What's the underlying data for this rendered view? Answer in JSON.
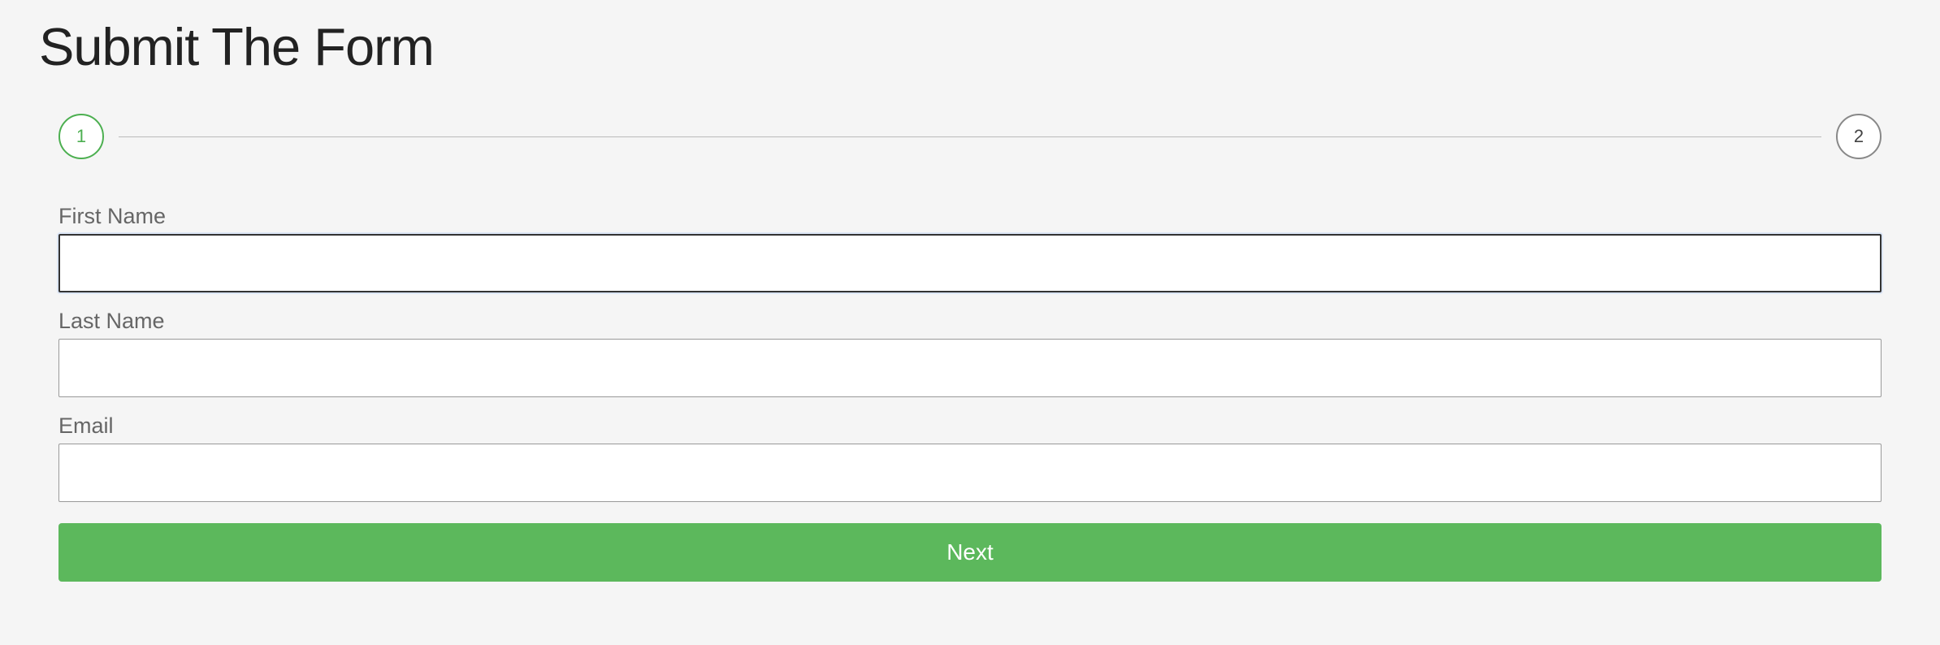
{
  "header": {
    "title": "Submit The Form"
  },
  "stepper": {
    "steps": [
      "1",
      "2"
    ],
    "active_index": 0
  },
  "form": {
    "fields": [
      {
        "label": "First Name",
        "value": "",
        "focused": true
      },
      {
        "label": "Last Name",
        "value": "",
        "focused": false
      },
      {
        "label": "Email",
        "value": "",
        "focused": false
      }
    ],
    "next_label": "Next"
  },
  "colors": {
    "accent": "#5cb85c",
    "step_active": "#4CAF50"
  }
}
